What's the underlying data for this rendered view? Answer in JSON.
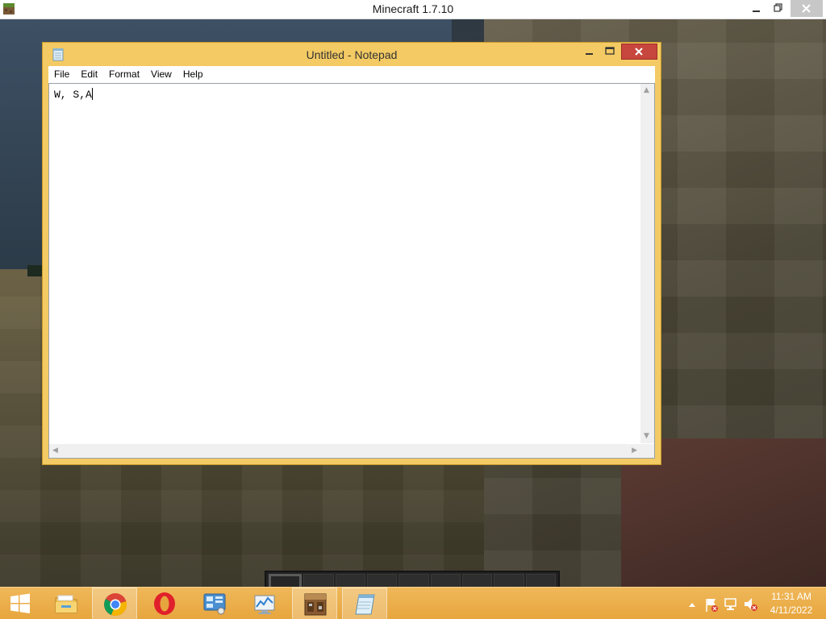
{
  "minecraft": {
    "window_title": "Minecraft 1.7.10",
    "icon": "minecraft-grass-block-icon",
    "hotbar": {
      "slots": 9,
      "selected_slot": 1
    }
  },
  "notepad": {
    "window_title": "Untitled - Notepad",
    "icon": "notepad-icon",
    "menu": [
      "File",
      "Edit",
      "Format",
      "View",
      "Help"
    ],
    "content": "W, S,A"
  },
  "taskbar": {
    "start_icon": "windows-start-icon",
    "pinned": [
      {
        "name": "file-explorer-icon",
        "active": false
      },
      {
        "name": "chrome-icon",
        "active": true
      },
      {
        "name": "opera-icon",
        "active": false
      },
      {
        "name": "control-panel-icon",
        "active": false
      },
      {
        "name": "resource-monitor-icon",
        "active": false
      },
      {
        "name": "minecraft-crafting-table-icon",
        "active": true
      },
      {
        "name": "notepad-icon",
        "active": true
      }
    ],
    "tray_icons": [
      "show-hidden-icons-chevron",
      "action-center-flag-icon",
      "network-icon",
      "volume-muted-icon"
    ],
    "clock": {
      "time": "11:31 AM",
      "date": "4/11/2022"
    }
  },
  "colors": {
    "taskbar": "#e7a53d",
    "notepad_frame": "#f3ca63",
    "close_button": "#c7463d"
  }
}
